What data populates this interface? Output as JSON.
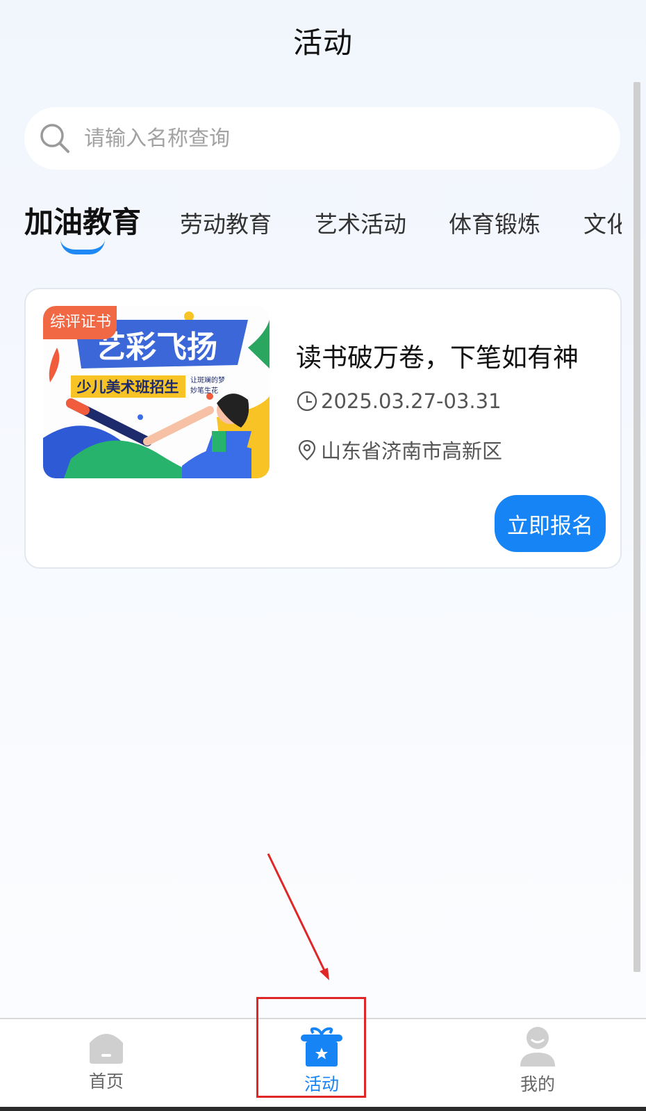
{
  "header": {
    "title": "活动"
  },
  "search": {
    "placeholder": "请输入名称查询",
    "value": ""
  },
  "tabs": [
    {
      "label": "加油教育",
      "active": true
    },
    {
      "label": "劳动教育",
      "active": false
    },
    {
      "label": "艺术活动",
      "active": false
    },
    {
      "label": "体育锻炼",
      "active": false
    },
    {
      "label": "文化",
      "active": false
    }
  ],
  "activity_card": {
    "tag": "综评证书",
    "poster_text": {
      "headline": "艺彩飞扬",
      "banner": "少儿美术班招生",
      "slogan_line1": "让斑斓的梦",
      "slogan_line2": "妙笔生花"
    },
    "title": "读书破万卷，下笔如有神",
    "date": "2025.03.27-03.31",
    "location": "山东省济南市高新区",
    "signup_label": "立即报名",
    "icons": {
      "date": "clock-icon",
      "location": "location-pin-icon"
    }
  },
  "tabbar": [
    {
      "label": "首页",
      "icon": "home-icon",
      "active": false
    },
    {
      "label": "活动",
      "icon": "activity-gift-icon",
      "active": true
    },
    {
      "label": "我的",
      "icon": "profile-icon",
      "active": false
    }
  ],
  "colors": {
    "accent": "#1784f5",
    "tag": "#f16845",
    "annotation": "#e02727"
  }
}
